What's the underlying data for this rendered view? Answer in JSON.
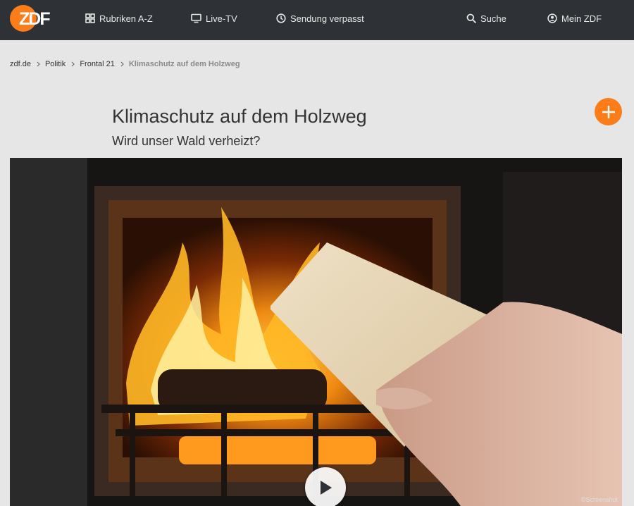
{
  "header": {
    "logo_text": "ZDF",
    "nav": [
      {
        "label": "Rubriken A-Z",
        "icon": "grid-icon"
      },
      {
        "label": "Live-TV",
        "icon": "tv-icon"
      },
      {
        "label": "Sendung verpasst",
        "icon": "clock-icon"
      },
      {
        "label": "Suche",
        "icon": "search-icon"
      },
      {
        "label": "Mein ZDF",
        "icon": "user-icon"
      }
    ]
  },
  "breadcrumb": {
    "items": [
      "zdf.de",
      "Politik",
      "Frontal 21"
    ],
    "current": "Klimaschutz auf dem Holzweg"
  },
  "article": {
    "title": "Klimaschutz auf dem Holzweg",
    "subtitle": "Wird unser Wald verheizt?"
  },
  "video": {
    "copyright": "©Screenshot",
    "description_icon": "play-icon"
  },
  "colors": {
    "header_bg": "#2e3236",
    "accent": "#fa7d19",
    "page_bg": "#e6e6e6"
  }
}
